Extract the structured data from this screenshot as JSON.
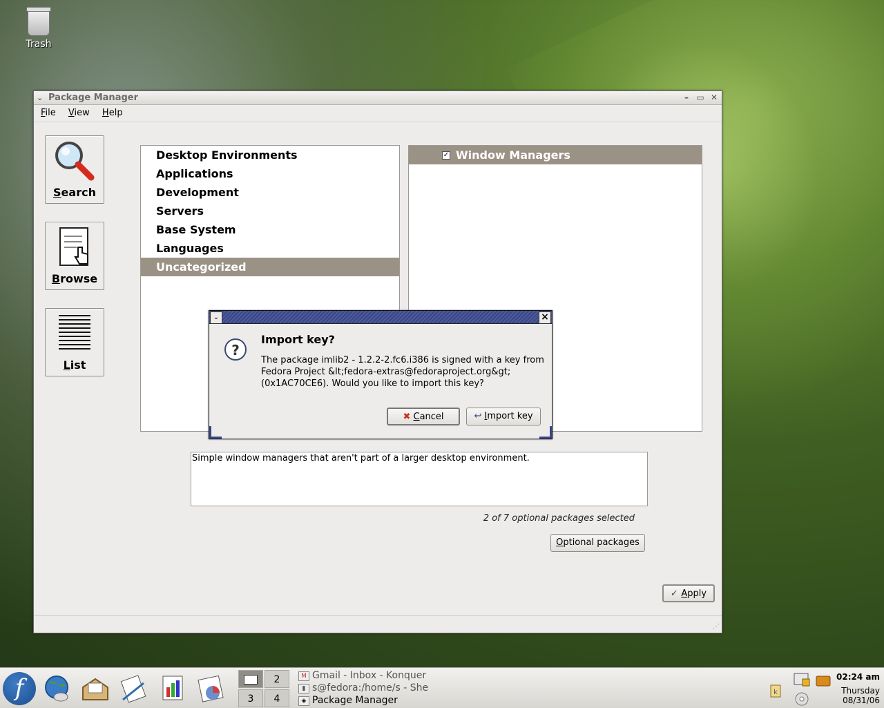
{
  "desktop": {
    "trash_label": "Trash"
  },
  "window": {
    "title": "Package Manager",
    "menu": [
      {
        "label": "File",
        "mnemonic": "F",
        "rest": "ile"
      },
      {
        "label": "View",
        "mnemonic": "V",
        "rest": "iew"
      },
      {
        "label": "Help",
        "mnemonic": "H",
        "rest": "elp"
      }
    ],
    "sidebar": {
      "search_mn": "S",
      "search_rest": "earch",
      "browse_mn": "B",
      "browse_rest": "rowse",
      "list_mn": "L",
      "list_rest": "ist"
    },
    "groups": [
      "Desktop Environments",
      "Applications",
      "Development",
      "Servers",
      "Base System",
      "Languages",
      "Uncategorized"
    ],
    "selected_group": "Uncategorized",
    "package_header": "Window Managers",
    "description": "Simple window managers that aren't part of a larger desktop environment.",
    "selected_count": "2 of 7 optional packages selected",
    "optional_btn_mn": "O",
    "optional_btn_rest": "ptional packages",
    "apply_mn": "A",
    "apply_rest": "pply"
  },
  "dialog": {
    "heading": "Import key?",
    "body_line1": "The package imlib2 - 1.2.2-2.fc6.i386 is signed with a key from",
    "body_line2": "Fedora Project &lt;fedora-extras@fedoraproject.org&gt;",
    "body_line3": "(0x1AC70CE6).  Would you like to import this key?",
    "cancel_mn": "C",
    "cancel_rest": "ancel",
    "import_mn": "I",
    "import_rest": "mport key"
  },
  "taskbar": {
    "pager": [
      "2",
      "3",
      "4"
    ],
    "tasks": [
      "Gmail - Inbox - Konquer",
      "s@fedora:/home/s - She",
      "Package Manager"
    ],
    "clock_time": "02:24 am",
    "clock_day": "Thursday",
    "clock_date": "08/31/06"
  }
}
